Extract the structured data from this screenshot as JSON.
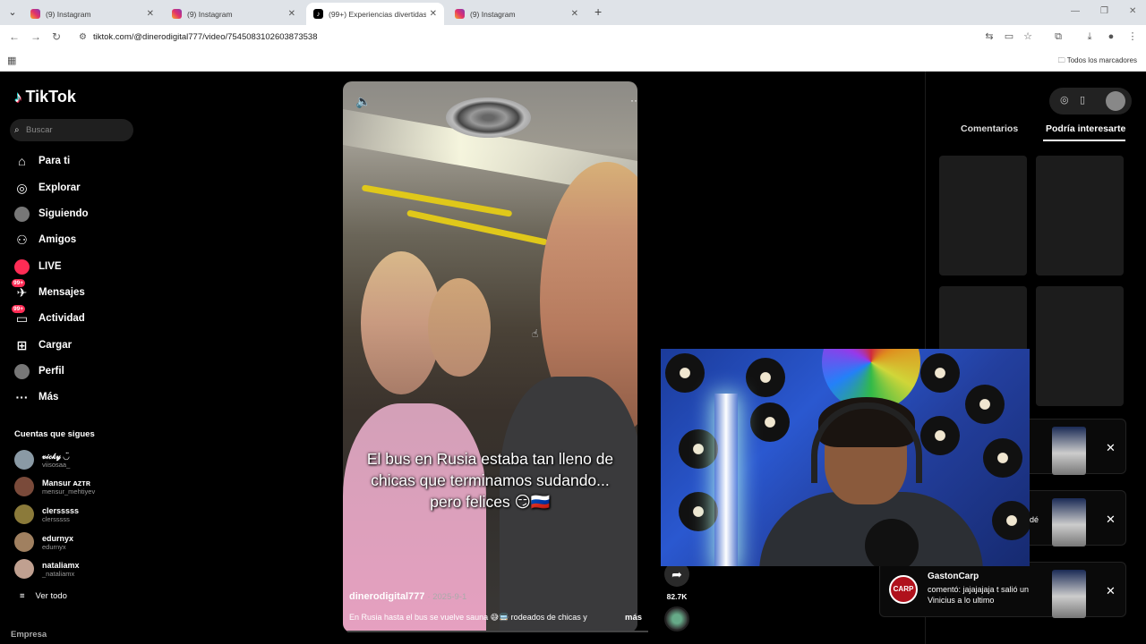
{
  "browser": {
    "tabs": [
      {
        "title": "(9) Instagram",
        "favicon": "instagram-icon",
        "active": false
      },
      {
        "title": "(9) Instagram",
        "favicon": "instagram-icon",
        "active": false
      },
      {
        "title": "(99+) Experiencias divertidas en",
        "favicon": "tiktok-icon",
        "active": true
      },
      {
        "title": "(9) Instagram",
        "favicon": "instagram-icon",
        "active": false
      }
    ],
    "url": "tiktok.com/@dinerodigital777/video/7545083102603873538",
    "bookmarks_all": "Todos los marcadores"
  },
  "tiktok": {
    "brand": "TikTok",
    "search_placeholder": "Buscar",
    "nav": [
      {
        "label": "Para ti",
        "icon": "home-icon"
      },
      {
        "label": "Explorar",
        "icon": "compass-icon"
      },
      {
        "label": "Siguiendo",
        "icon": "following-avatar-icon"
      },
      {
        "label": "Amigos",
        "icon": "friends-icon"
      },
      {
        "label": "LIVE",
        "icon": "live-icon"
      },
      {
        "label": "Mensajes",
        "icon": "messages-icon",
        "badge": "99+"
      },
      {
        "label": "Actividad",
        "icon": "activity-icon",
        "badge": "99+"
      },
      {
        "label": "Cargar",
        "icon": "upload-icon"
      },
      {
        "label": "Perfil",
        "icon": "profile-icon"
      },
      {
        "label": "Más",
        "icon": "more-icon"
      }
    ],
    "following_title": "Cuentas que sigues",
    "following": [
      {
        "name": "𝓋𝒾𝒸𝓀𝓎 ◡̈",
        "handle": "viisosaa_"
      },
      {
        "name": "Mansur ᴀᴢᴛʀ",
        "handle": "mensur_mehtiyev"
      },
      {
        "name": "clersssss",
        "handle": "clersssss"
      },
      {
        "name": "edurnyx",
        "handle": "edurnyx"
      },
      {
        "name": "nataliamx",
        "handle": "_nataliamx"
      }
    ],
    "see_all": "Ver todo",
    "footer": "Empresa"
  },
  "video": {
    "caption_lines": [
      "El bus en Rusia estaba tan lleno de",
      "chicas que terminamos sudando...",
      "pero felices 😏🇷🇺"
    ],
    "author": "dinerodigital777",
    "date": "2025-9-1",
    "description": "En Rusia hasta el bus se vuelve sauna 😅🚍 rodeados de chicas y",
    "more": "más",
    "share_count": "82.7K"
  },
  "right_panel": {
    "tab_comments": "Comentarios",
    "tab_interest": "Podría interesarte",
    "fragment": "dé"
  },
  "notification": {
    "user": "GastonCarp",
    "text": "comentó: jajajajaja t salió un Vinicius a lo ultimo",
    "avatar_text": "CARP"
  },
  "colors": {
    "accent": "#fe2c55",
    "background": "#000000",
    "tab_bar": "#dfe3e8"
  }
}
